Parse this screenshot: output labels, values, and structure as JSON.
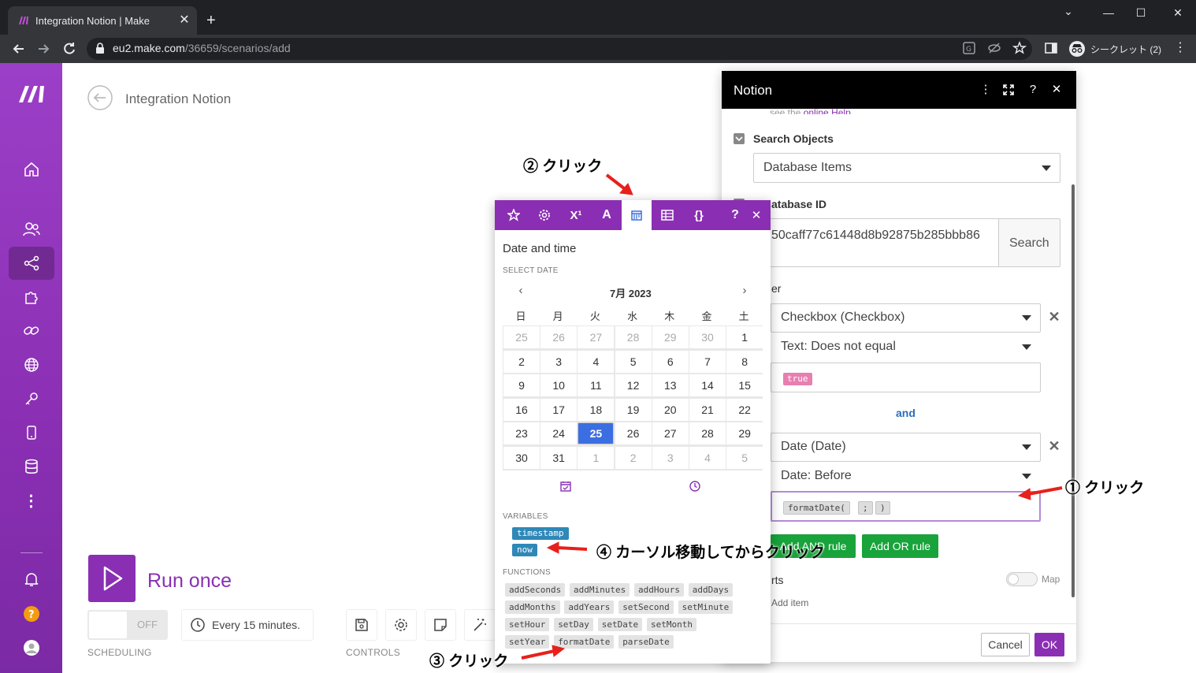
{
  "browser": {
    "tab_title": "Integration Notion | Make",
    "url_host": "eu2.make.com",
    "url_path": "/36659/scenarios/add",
    "incognito_label": "シークレット (2)"
  },
  "scenario": {
    "title": "Integration Notion",
    "run_label": "Run once",
    "toggle_text": "OFF",
    "schedule_text": "Every 15 minutes.",
    "scheduling_label": "SCHEDULING",
    "controls_label": "CONTROLS"
  },
  "panel": {
    "title": "Notion",
    "help_text": "see the ",
    "help_link": "online Help.",
    "search_objects_label": "Search Objects",
    "search_objects_value": "Database Items",
    "database_id_label": "atabase ID",
    "database_id_value": "50caff77c61448d8b92875b285bbb86",
    "search_button": "Search",
    "filter_label": "er",
    "rule1_field": "Checkbox (Checkbox)",
    "rule1_operator": "Text: Does not equal",
    "rule1_value": "true",
    "and_label": "and",
    "rule2_field": "Date (Date)",
    "rule2_operator": "Date: Before",
    "rule2_tokens": [
      "formatDate(",
      ";",
      ")"
    ],
    "add_and_rule": "Add AND rule",
    "add_or_rule": "Add OR rule",
    "sorts_label": "rts",
    "map_label": "Map",
    "add_item": "Add item",
    "cancel": "Cancel",
    "ok": "OK"
  },
  "popup": {
    "title": "Date and time",
    "select_date_label": "SELECT DATE",
    "month": "7月 2023",
    "weekdays": [
      "日",
      "月",
      "火",
      "水",
      "木",
      "金",
      "土"
    ],
    "days": [
      [
        "25",
        "26",
        "27",
        "28",
        "29",
        "30",
        "1"
      ],
      [
        "2",
        "3",
        "4",
        "5",
        "6",
        "7",
        "8"
      ],
      [
        "9",
        "10",
        "11",
        "12",
        "13",
        "14",
        "15"
      ],
      [
        "16",
        "17",
        "18",
        "19",
        "20",
        "21",
        "22"
      ],
      [
        "23",
        "24",
        "25",
        "26",
        "27",
        "28",
        "29"
      ],
      [
        "30",
        "31",
        "1",
        "2",
        "3",
        "4",
        "5"
      ]
    ],
    "selected_day": "25",
    "variables_label": "VARIABLES",
    "variables": [
      "timestamp",
      "now"
    ],
    "functions_label": "FUNCTIONS",
    "functions": [
      [
        "addSeconds",
        "addMinutes",
        "addHours",
        "addDays"
      ],
      [
        "addMonths",
        "addYears",
        "setSecond",
        "setMinute"
      ],
      [
        "setHour",
        "setDay",
        "setDate",
        "setMonth"
      ],
      [
        "setYear",
        "formatDate",
        "parseDate"
      ]
    ]
  },
  "annotations": {
    "step1": "① クリック",
    "step2": "② クリック",
    "step3": "③ クリック",
    "step4": "④ カーソル移動してからクリック"
  },
  "colors": {
    "brand": "#8a2fb3",
    "green": "#18a33b",
    "selected_day": "#3b6ee0",
    "variable_pill": "#2f88b8",
    "true_pill": "#e77fb0",
    "annotation_arrow": "#e8201a"
  }
}
